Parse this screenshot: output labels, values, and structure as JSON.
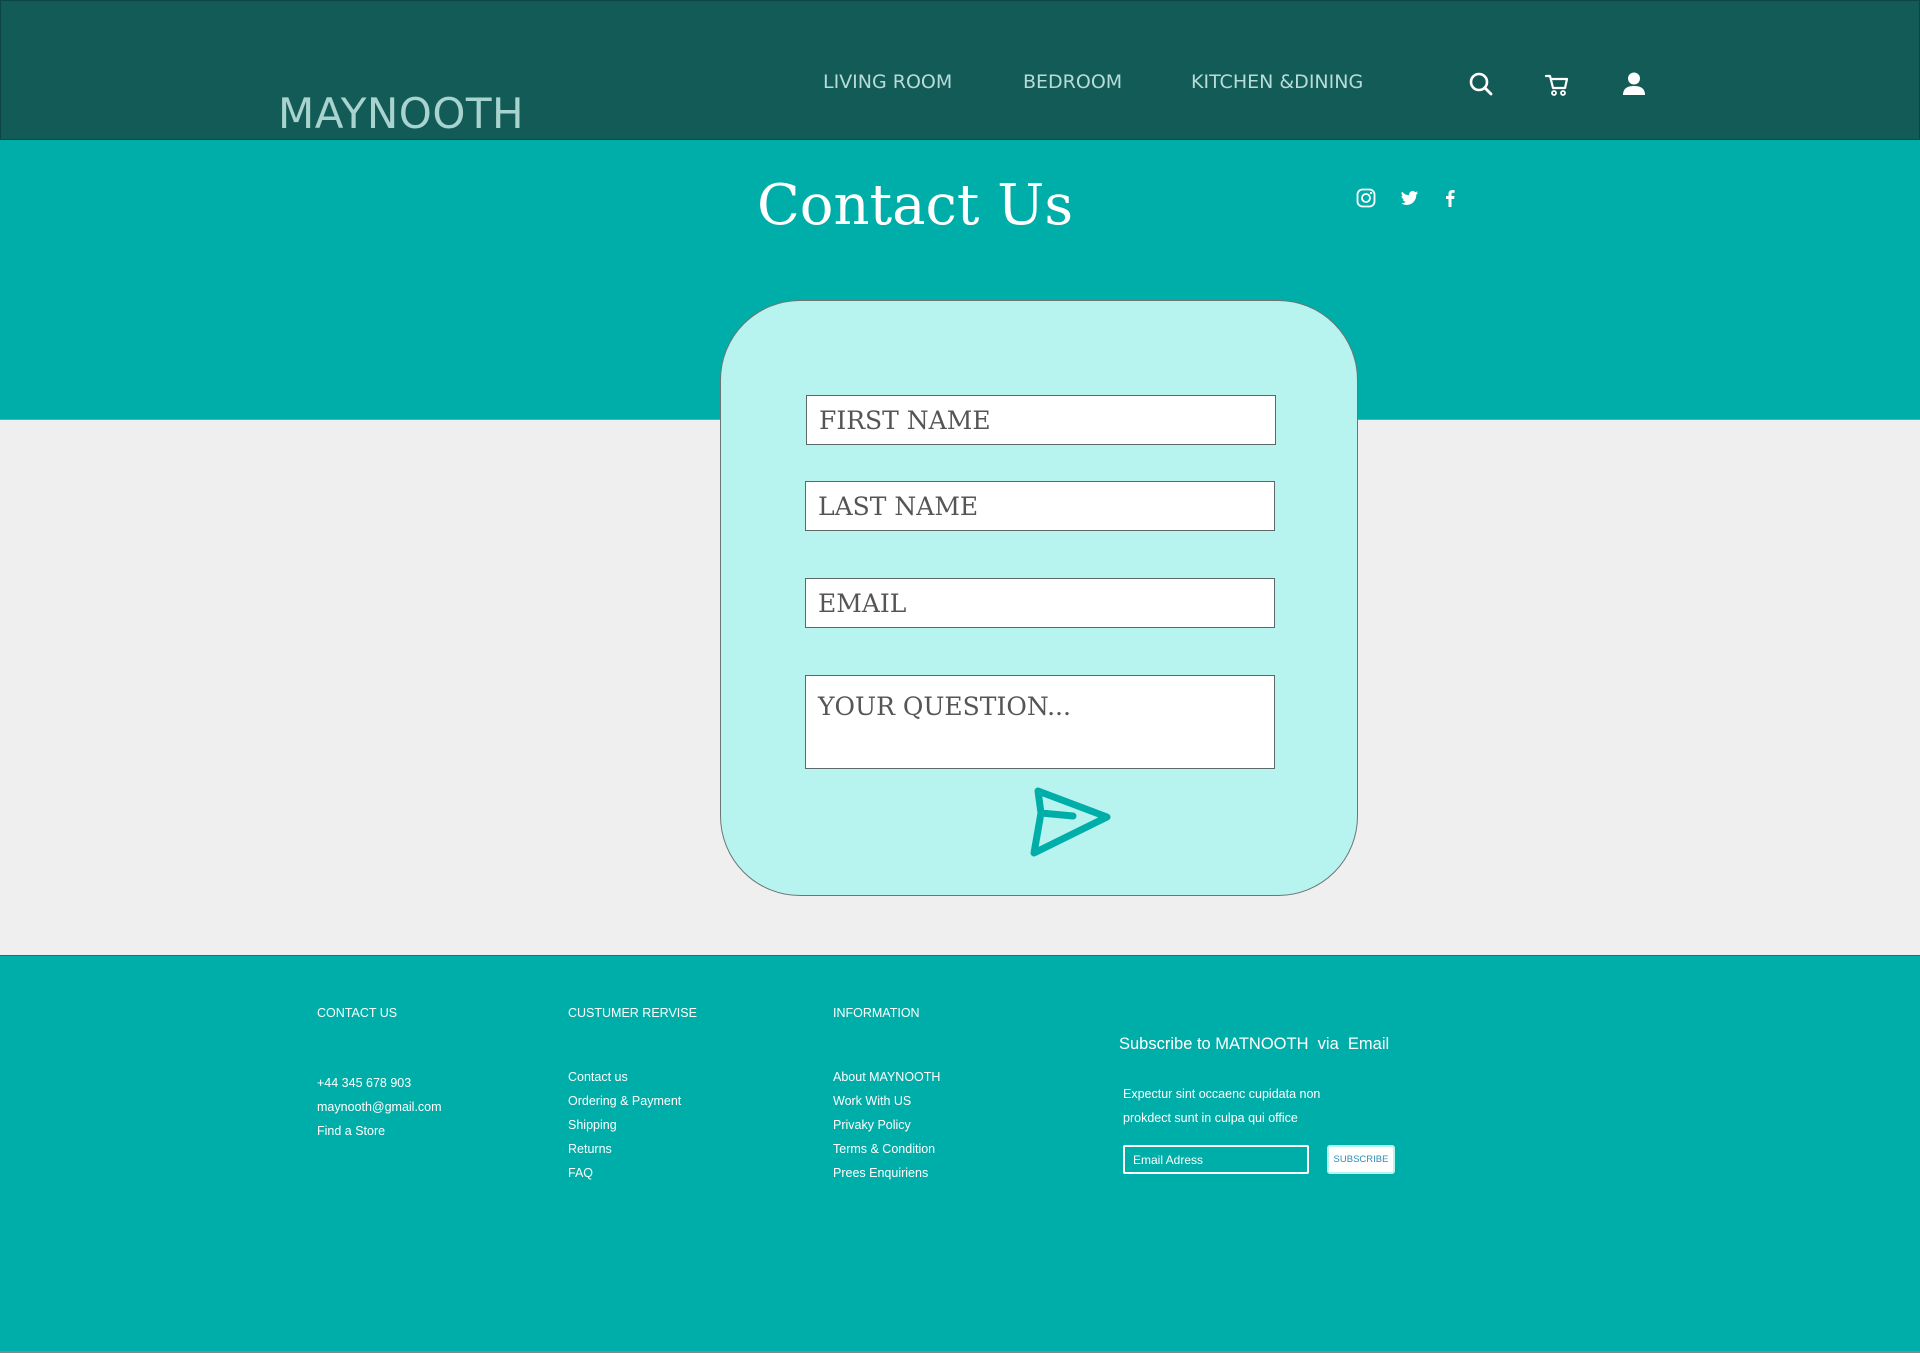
{
  "header": {
    "logo": "MAYNOOTH",
    "nav": [
      {
        "label": "LIVING ROOM"
      },
      {
        "label": "BEDROOM"
      },
      {
        "label": "KITCHEN &DINING"
      }
    ],
    "icons": [
      "search-icon",
      "cart-icon",
      "user-icon"
    ]
  },
  "hero": {
    "title": "Contact Us",
    "social": [
      "instagram-icon",
      "twitter-icon",
      "facebook-icon"
    ]
  },
  "form": {
    "first_name_placeholder": "FIRST NAME",
    "last_name_placeholder": "LAST NAME",
    "email_placeholder": "EMAIL",
    "question_placeholder": "YOUR QUESTION...",
    "send_icon": "send-icon"
  },
  "footer": {
    "contact": {
      "heading": "CONTACT US",
      "items": [
        "+44 345 678 903",
        "maynooth@gmail.com",
        "Find a Store"
      ]
    },
    "service": {
      "heading": "CUSTUMER RERVISE",
      "items": [
        "Contact  us",
        "Ordering & Payment",
        "Shipping",
        "Returns",
        "FAQ"
      ]
    },
    "information": {
      "heading": "INFORMATION",
      "items": [
        "About MAYNOOTH",
        "Work With US",
        "Privaky Policy",
        "Terms & Condition",
        "Prees Enquiriens"
      ]
    },
    "subscribe": {
      "title": "Subscribe to MATNOOTH  via  Email",
      "text_line1": "Expectur sint occaenc cupidata non",
      "text_line2": "prokdect sunt in culpa qui office",
      "input_placeholder": "Email Adress",
      "button_label": "SUBSCRIBE"
    }
  },
  "colors": {
    "header_bg": "#135b57",
    "teal": "#00aea9",
    "card_bg": "#b8f4ef",
    "page_bg": "#efefef"
  }
}
